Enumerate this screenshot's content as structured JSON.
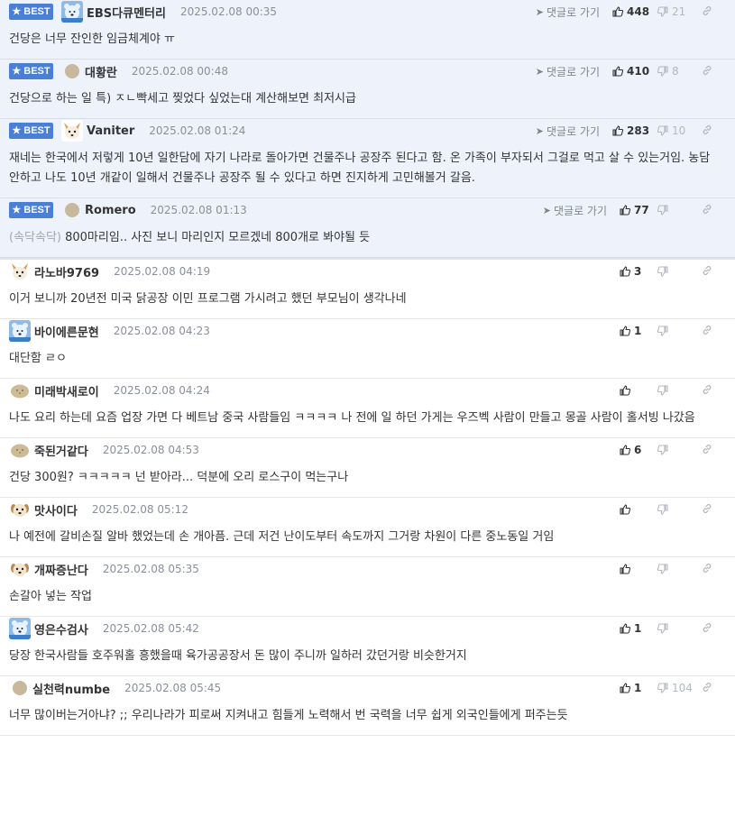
{
  "badge_label": "BEST",
  "reply_label": "댓글로 가기",
  "comments": [
    {
      "best": true,
      "avatar": "bluebear",
      "nickname": "EBS다큐멘터리",
      "date": "2025.02.08 00:35",
      "up": "448",
      "down": "21",
      "body": "건당은 너무 잔인한 임금체계야 ㅠ"
    },
    {
      "best": true,
      "avatar": "dot",
      "nickname": "대황란",
      "date": "2025.02.08 00:48",
      "up": "410",
      "down": "8",
      "body": "건당으로 하는 일 특) ㅈㄴ빡세고 찢었다 싶었는대 계산해보면 최저시급"
    },
    {
      "best": true,
      "avatar": "fox",
      "nickname": "Vaniter",
      "date": "2025.02.08 01:24",
      "up": "283",
      "down": "10",
      "body": "재네는 한국에서 저렇게 10년 일한담에 자기 나라로 돌아가면 건물주나 공장주 된다고 함. 온 가족이 부자되서 그걸로 먹고 살 수 있는거임. 농담 안하고 나도 10년 개같이 일해서 건물주나 공장주 될 수 있다고 하면 진지하게 고민해볼거 갈음."
    },
    {
      "best": true,
      "avatar": "dot",
      "nickname": "Romero",
      "date": "2025.02.08 01:13",
      "up": "77",
      "down": "",
      "prefix": "(속닥속닥)",
      "body": " 800마리임.. 사진 보니 마리인지 모르겠네 800개로 봐야될 듯"
    },
    {
      "best": false,
      "avatar": "fox",
      "nickname": "라노바9769",
      "date": "2025.02.08 04:19",
      "up": "3",
      "down": "",
      "body": "이거 보니까 20년전 미국 닭공장 이민 프로그램 가시려고 했던 부모님이 생각나네"
    },
    {
      "best": false,
      "avatar": "bluebear",
      "nickname": "바이에른문현",
      "date": "2025.02.08 04:23",
      "up": "1",
      "down": "",
      "body": "대단함 ㄹㅇ"
    },
    {
      "best": false,
      "avatar": "potato",
      "nickname": "미래박새로이",
      "date": "2025.02.08 04:24",
      "up": "",
      "down": "",
      "body": "나도 요리 하는데 요즘 업장 가면 다 베트남 중국 사람들임 ㅋㅋㅋㅋ 나 전에 일 하던 가게는 우즈벡 사람이 만들고 몽골 사람이 홀서빙 나갔음"
    },
    {
      "best": false,
      "avatar": "potato",
      "nickname": "죽된거같다",
      "date": "2025.02.08 04:53",
      "up": "6",
      "down": "",
      "body": "건당 300원? ㅋㅋㅋㅋㅋ 넌 받아라... 덕분에 오리 로스구이 먹는구나"
    },
    {
      "best": false,
      "avatar": "dog",
      "nickname": "맛사이다",
      "date": "2025.02.08 05:12",
      "up": "",
      "down": "",
      "body": "나 예전에 갈비손질 알바 했었는데 손 개아픔. 근데 저건 난이도부터 속도까지 그거랑 차원이 다른 중노동일 거임"
    },
    {
      "best": false,
      "avatar": "dog",
      "nickname": "개짜증난다",
      "date": "2025.02.08 05:35",
      "up": "",
      "down": "",
      "body": "손갈아 넣는 작업"
    },
    {
      "best": false,
      "avatar": "bluebear",
      "nickname": "영은수검사",
      "date": "2025.02.08 05:42",
      "up": "1",
      "down": "",
      "body": "당장 한국사람들 호주워홀 흥했을때 육가공공장서 돈 많이 주니까 일하러 갔던거랑 비슷한거지"
    },
    {
      "best": false,
      "avatar": "dot",
      "nickname": "실천력numbe",
      "date": "2025.02.08 05:45",
      "up": "1",
      "down": "104",
      "body": "너무 많이버는거아냐? ;; 우리나라가 피로써 지켜내고 힘들게 노력해서 번 국력을 너무 쉽게 외국인들에게 퍼주는듯"
    }
  ]
}
